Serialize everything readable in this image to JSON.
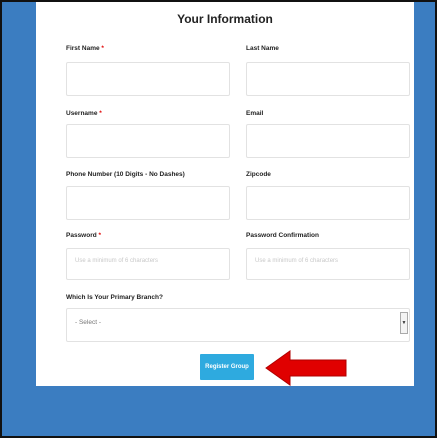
{
  "form": {
    "title": "Your Information",
    "first_name": {
      "label": "First Name",
      "required": "*"
    },
    "last_name": {
      "label": "Last Name"
    },
    "username": {
      "label": "Username",
      "required": "*"
    },
    "email": {
      "label": "Email"
    },
    "phone": {
      "label": "Phone Number (10 Digits - No Dashes)"
    },
    "zipcode": {
      "label": "Zipcode"
    },
    "password": {
      "label": "Password",
      "required": "*",
      "placeholder": "Use a minimum of 6 characters"
    },
    "password_confirmation": {
      "label": "Password Confirmation",
      "placeholder": "Use a minimum of 6 characters"
    },
    "branch": {
      "label": "Which Is Your Primary Branch?",
      "selected": "- Select -"
    },
    "register_label": "Register Group"
  },
  "colors": {
    "background": "#3b7dc1",
    "button": "#2eaadf",
    "arrow": "#e00000",
    "required": "#e00000"
  },
  "icons": {
    "arrow": "red-left-arrow-icon",
    "dropdown": "chevron-down-icon"
  }
}
